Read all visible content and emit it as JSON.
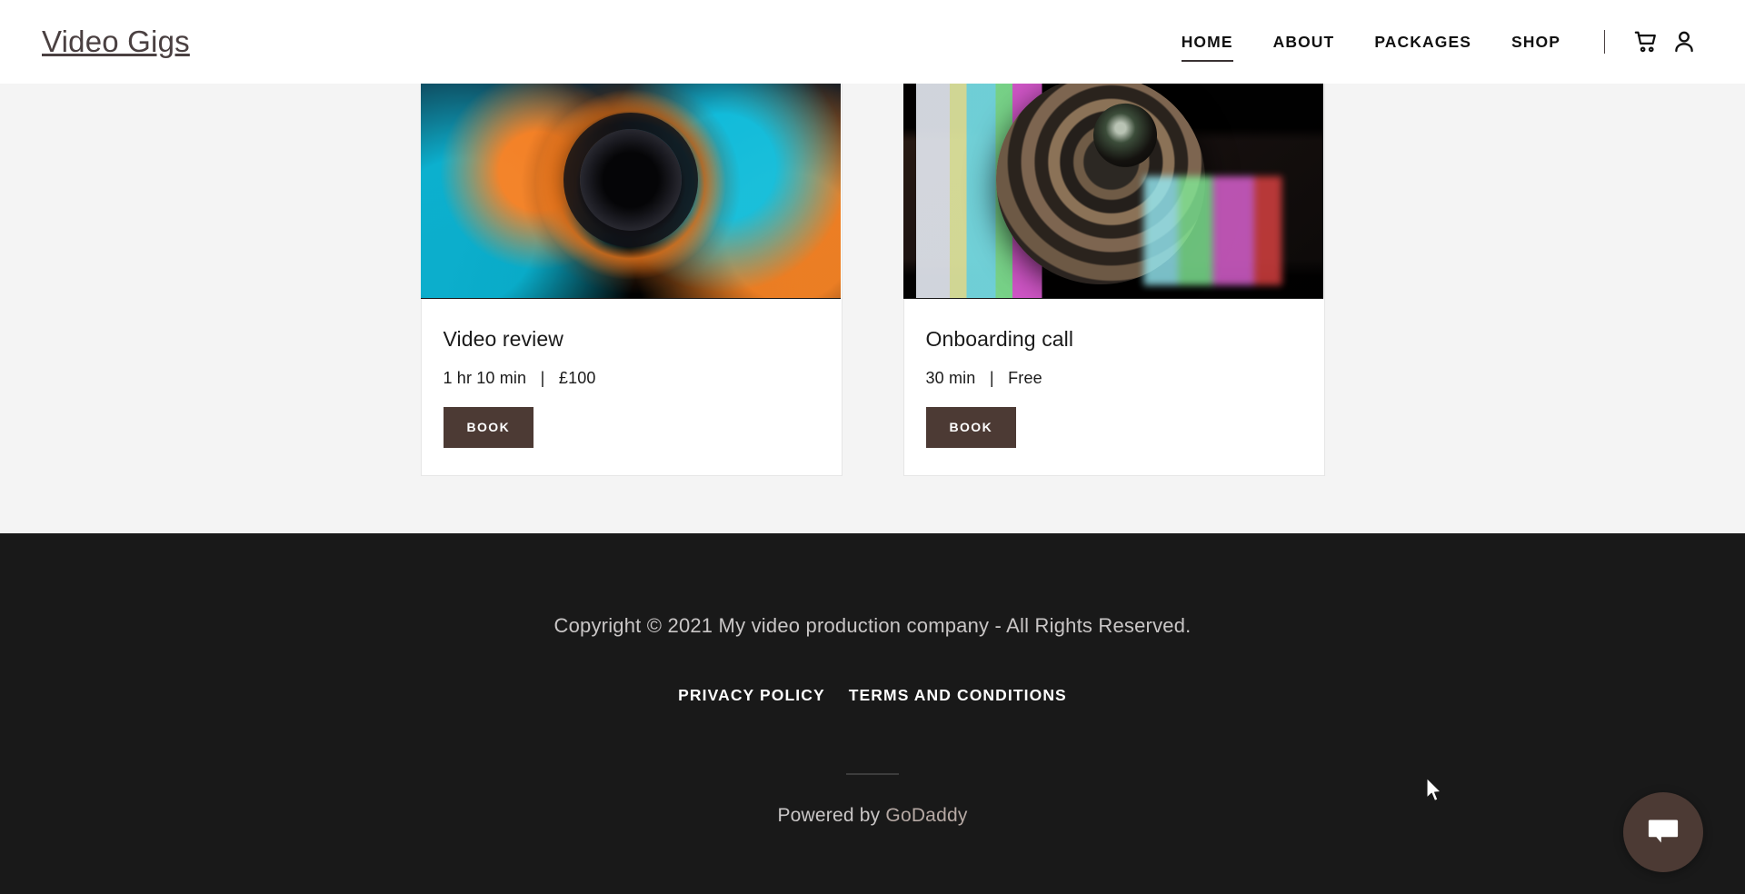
{
  "header": {
    "brand": "Video Gigs",
    "nav_items": [
      {
        "label": "HOME",
        "active": true
      },
      {
        "label": "ABOUT",
        "active": false
      },
      {
        "label": "PACKAGES",
        "active": false
      },
      {
        "label": "SHOP",
        "active": false
      }
    ],
    "icons": {
      "cart": "shopping-cart-icon",
      "account": "user-account-icon"
    }
  },
  "main": {
    "cards": [
      {
        "title": "Video review",
        "duration": "1 hr 10 min",
        "separator": "|",
        "price": "£100",
        "meta": "1 hr 10 min   |   £100",
        "button_label": "BOOK",
        "image_alt": "camera-lens-orange-teal"
      },
      {
        "title": "Onboarding call",
        "duration": "30 min",
        "separator": "|",
        "price": "Free",
        "meta": "30 min   |   Free",
        "button_label": "BOOK",
        "image_alt": "camera-lens-colour-bars"
      }
    ]
  },
  "footer": {
    "copyright": "Copyright © 2021 My video production company - All Rights Reserved.",
    "links": [
      {
        "label": "PRIVACY POLICY"
      },
      {
        "label": "TERMS AND CONDITIONS"
      }
    ],
    "powered_by_prefix": "Powered by ",
    "powered_by_brand": "GoDaddy"
  },
  "chat": {
    "icon": "chat-bubble-icon",
    "aria_label": "Open chat"
  },
  "colors": {
    "page_background": "#f4f4f4",
    "header_background": "#ffffff",
    "footer_background": "#191919",
    "accent_brown": "#4c3a34",
    "nav_text": "#111111",
    "brand_text": "#4a4041",
    "footer_text": "#c9c6c6",
    "godaddy_link": "#b6a9a4"
  }
}
